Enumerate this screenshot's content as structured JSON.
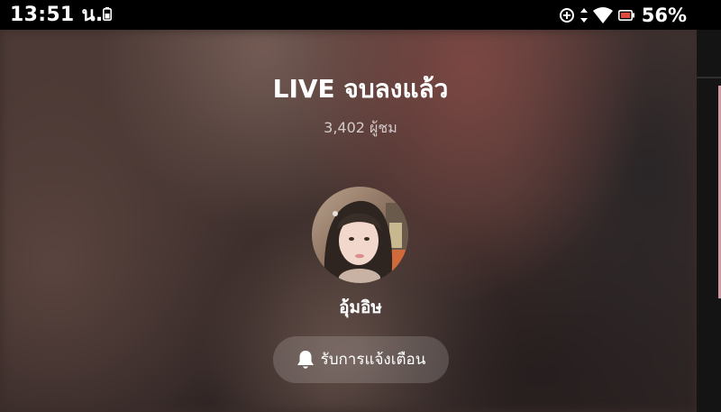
{
  "status_bar": {
    "time": "13:51 น.",
    "battery_percent": "56%",
    "icons": [
      "battery-saver-icon",
      "data-saver-icon",
      "data-arrows-icon",
      "wifi-icon",
      "battery-icon"
    ]
  },
  "live_end": {
    "title": "LIVE จบลงแล้ว",
    "viewer_count": "3,402 ผู้ชม",
    "host_name": "อุ้มอิษ",
    "notify_label": "รับการแจ้งเตือน",
    "notify_icon": "bell-icon"
  },
  "colors": {
    "status_bar_bg": "#000000",
    "text_primary": "#ffffff",
    "button_bg": "rgba(255,255,255,0.16)",
    "battery_low_accent": "#e04a3a"
  }
}
